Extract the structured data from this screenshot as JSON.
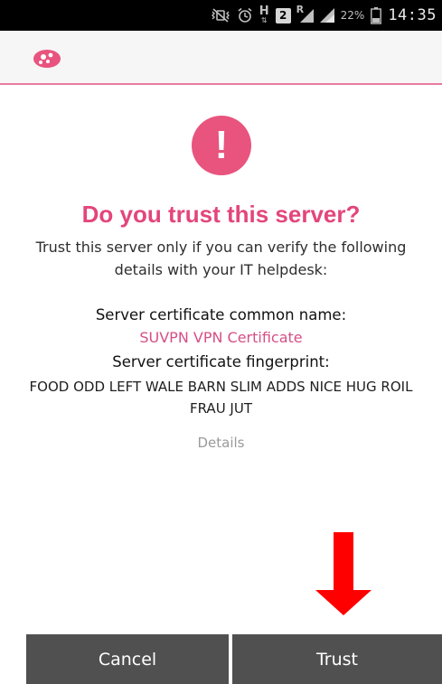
{
  "status_bar": {
    "icons": [
      "mute-vibrate-icon",
      "alarm-icon",
      "h-signal-icon",
      "sim2-icon",
      "roaming-signal-icon",
      "signal-icon",
      "battery-icon"
    ],
    "h_label": "H",
    "sim_label": "2",
    "roaming_label": "R",
    "battery_percent": "22%",
    "time": "14:35"
  },
  "app_bar": {
    "logo_icon": "app-logo-icon",
    "accent_color": "#e8547e"
  },
  "dialog": {
    "alert_icon": "exclamation-icon",
    "alert_symbol": "!",
    "title": "Do you trust this server?",
    "subtitle": "Trust this server only if you can verify the following details with your IT helpdesk:",
    "common_name_label": "Server certificate common name:",
    "common_name_value": "SUVPN VPN Certificate",
    "fingerprint_label": "Server certificate fingerprint:",
    "fingerprint_value": "FOOD ODD LEFT WALE BARN SLIM ADDS NICE HUG ROIL FRAU JUT",
    "details_label": "Details"
  },
  "annotation": {
    "arrow_icon": "red-down-arrow-icon",
    "color": "#ff0000"
  },
  "buttons": {
    "cancel_label": "Cancel",
    "trust_label": "Trust"
  }
}
